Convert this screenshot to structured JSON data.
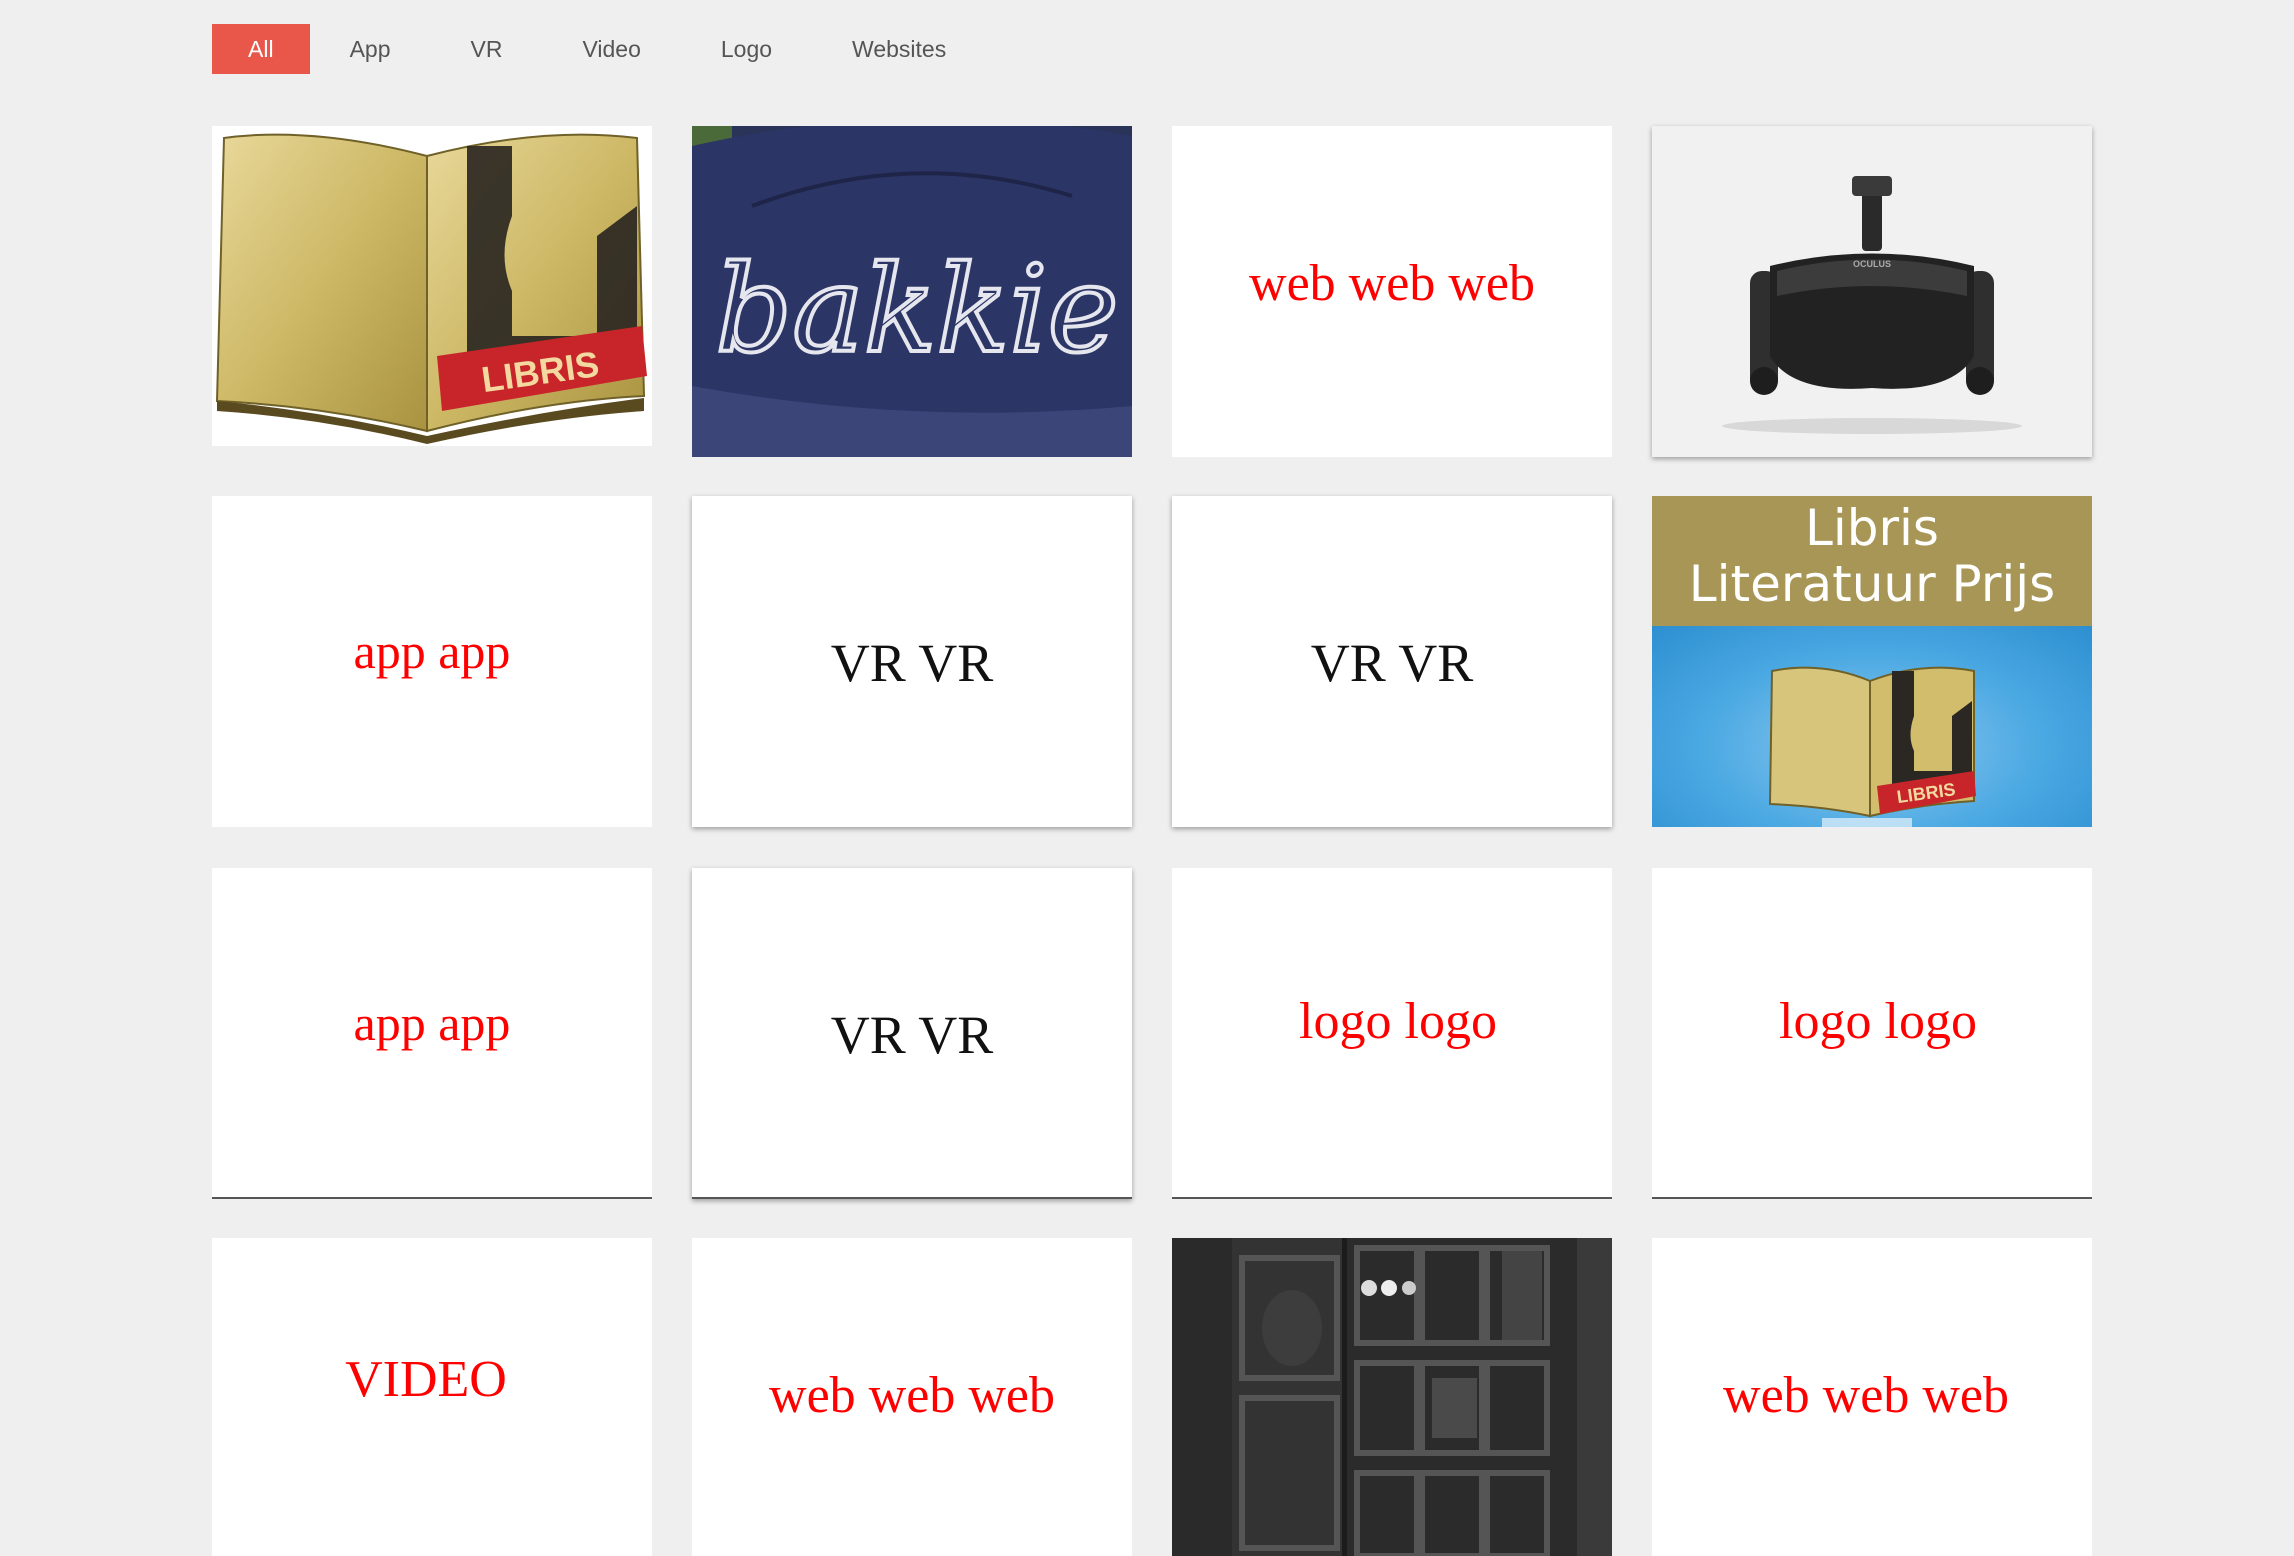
{
  "filters": [
    "All",
    "App",
    "VR",
    "Video",
    "Logo",
    "Websites"
  ],
  "active_filter": "All",
  "colors": {
    "accent": "#e8574a",
    "placeholder_text": "#ff0000",
    "background": "#efefef"
  },
  "tiles": [
    {
      "kind": "image",
      "image": "libris-book-logo",
      "logo_text": "LIBRIS"
    },
    {
      "kind": "image",
      "image": "bakkie-cap",
      "logo_text": "bakkie"
    },
    {
      "kind": "text",
      "text": "web web web"
    },
    {
      "kind": "image",
      "image": "vr-headset",
      "logo_text": "OCULUS"
    },
    {
      "kind": "text",
      "text": "app app"
    },
    {
      "kind": "text",
      "text": "VR VR"
    },
    {
      "kind": "text",
      "text": "VR VR"
    },
    {
      "kind": "image",
      "image": "libris-literatuur-prijs",
      "title_line1": "Libris",
      "title_line2": "Literatuur Prijs",
      "logo_text": "LIBRIS"
    },
    {
      "kind": "text",
      "text": "app app"
    },
    {
      "kind": "text",
      "text": "VR VR"
    },
    {
      "kind": "text",
      "text": "logo logo"
    },
    {
      "kind": "text",
      "text": "logo logo"
    },
    {
      "kind": "text",
      "text": "VIDEO"
    },
    {
      "kind": "text",
      "text": "web web web"
    },
    {
      "kind": "image",
      "image": "bw-window-photo"
    },
    {
      "kind": "text",
      "text": "web web web"
    }
  ]
}
